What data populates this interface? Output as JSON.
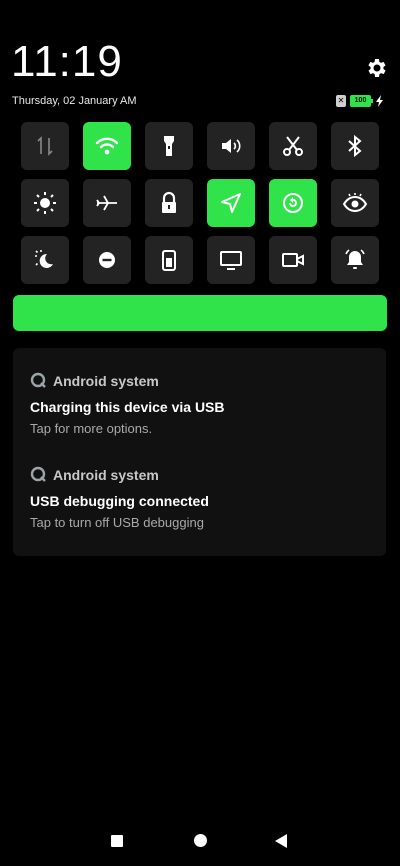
{
  "status": {
    "time": "11:19",
    "date": "Thursday, 02 January AM",
    "battery_level": "100",
    "sim_label": "✕"
  },
  "colors": {
    "accent": "#30e34a",
    "tile_off": "#232323",
    "card_bg": "#111111"
  },
  "quick_settings": [
    {
      "name": "mobile-data",
      "icon": "arrows-updown-icon",
      "active": false
    },
    {
      "name": "wifi",
      "icon": "wifi-icon",
      "active": true
    },
    {
      "name": "flashlight",
      "icon": "flashlight-icon",
      "active": false
    },
    {
      "name": "sound",
      "icon": "volume-icon",
      "active": false
    },
    {
      "name": "screenshot",
      "icon": "scissors-icon",
      "active": false
    },
    {
      "name": "bluetooth",
      "icon": "bluetooth-icon",
      "active": false
    },
    {
      "name": "auto-brightness",
      "icon": "sun-icon",
      "active": false
    },
    {
      "name": "airplane-mode",
      "icon": "airplane-icon",
      "active": false
    },
    {
      "name": "lock-screen",
      "icon": "lock-icon",
      "active": false
    },
    {
      "name": "location",
      "icon": "location-arrow-icon",
      "active": true
    },
    {
      "name": "auto-rotate",
      "icon": "rotate-icon",
      "active": true
    },
    {
      "name": "reading-mode",
      "icon": "eye-icon",
      "active": false
    },
    {
      "name": "dark-mode",
      "icon": "sun-moon-icon",
      "active": false
    },
    {
      "name": "do-not-disturb",
      "icon": "minus-circle-icon",
      "active": false
    },
    {
      "name": "battery-saver",
      "icon": "battery-icon",
      "active": false
    },
    {
      "name": "cast-screen",
      "icon": "monitor-icon",
      "active": false
    },
    {
      "name": "screen-record",
      "icon": "video-camera-icon",
      "active": false
    },
    {
      "name": "alarm",
      "icon": "bell-icon",
      "active": false
    }
  ],
  "notifications": [
    {
      "app": "Android system",
      "title": "Charging this device via USB",
      "text": "Tap for more options."
    },
    {
      "app": "Android system",
      "title": "USB debugging connected",
      "text": "Tap to turn off USB debugging"
    }
  ]
}
